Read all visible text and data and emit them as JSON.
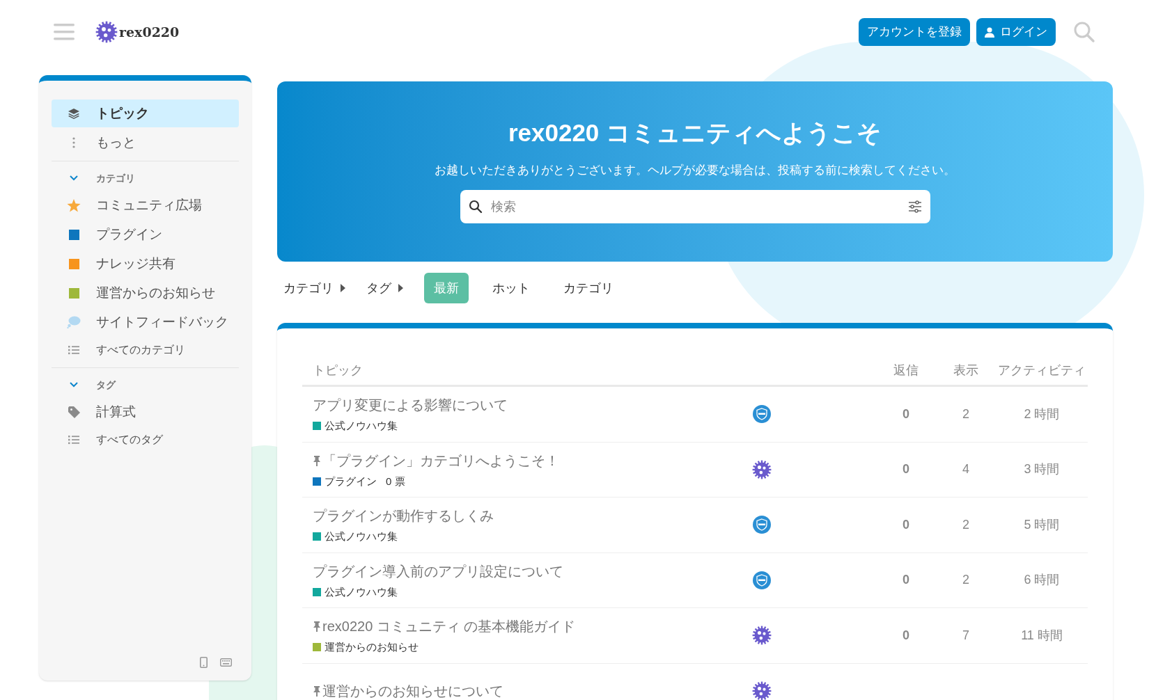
{
  "header": {
    "site_name": "rex0220",
    "buttons": [
      {
        "label": "アカウントを登録",
        "kind": "signup"
      },
      {
        "label": "ログイン",
        "kind": "login"
      }
    ]
  },
  "sidebar": {
    "top_items": [
      {
        "label": "トピック",
        "kind": "layers",
        "selected": true
      },
      {
        "label": "もっと",
        "kind": "dots",
        "selected": false
      }
    ],
    "sections": [
      {
        "title": "カテゴリ",
        "expanded": true,
        "items": [
          {
            "label": "コミュニティ広場",
            "kind": "star",
            "color": "#f7a93b"
          },
          {
            "label": "プラグイン",
            "kind": "square",
            "color": "#0e76bd"
          },
          {
            "label": "ナレッジ共有",
            "kind": "square",
            "color": "#f7941d"
          },
          {
            "label": "運営からのお知らせ",
            "kind": "square",
            "color": "#9eb83b"
          },
          {
            "label": "サイトフィードバック",
            "kind": "bubble",
            "color": "#b3d9f2"
          },
          {
            "label": "すべてのカテゴリ",
            "kind": "list"
          }
        ]
      },
      {
        "title": "タグ",
        "expanded": true,
        "items": [
          {
            "label": "計算式",
            "kind": "tag"
          },
          {
            "label": "すべてのタグ",
            "kind": "list"
          }
        ]
      }
    ]
  },
  "banner": {
    "title": "rex0220 コミュニティへようこそ",
    "subtitle": "お越しいただきありがとうございます。ヘルプが必要な場合は、投稿する前に検索してください。",
    "search": {
      "placeholder": "検索"
    }
  },
  "nav": {
    "dropdowns": [
      "カテゴリ",
      "タグ"
    ],
    "tabs": [
      {
        "label": "最新",
        "selected": true
      },
      {
        "label": "ホット",
        "selected": false
      },
      {
        "label": "カテゴリ",
        "selected": false
      }
    ]
  },
  "table": {
    "columns": [
      "トピック",
      "返信",
      "表示",
      "アクティビティ"
    ],
    "rows": [
      {
        "title": "アプリ変更による影響について",
        "pinned": false,
        "category": {
          "name": "公式ノウハウ集",
          "color": "#12a89d"
        },
        "avatar": {
          "kind": "staff"
        },
        "replies": "0",
        "views": "2",
        "activity": "2 時間"
      },
      {
        "title": "「プラグイン」カテゴリへようこそ！",
        "pinned": true,
        "category": {
          "name": "プラグイン",
          "color": "#0e76bd"
        },
        "votes": "0 票",
        "avatar": {
          "kind": "gear"
        },
        "replies": "0",
        "views": "4",
        "activity": "3 時間"
      },
      {
        "title": "プラグインが動作するしくみ",
        "pinned": false,
        "category": {
          "name": "公式ノウハウ集",
          "color": "#12a89d"
        },
        "avatar": {
          "kind": "staff"
        },
        "replies": "0",
        "views": "2",
        "activity": "5 時間"
      },
      {
        "title": "プラグイン導入前のアプリ設定について",
        "pinned": false,
        "category": {
          "name": "公式ノウハウ集",
          "color": "#12a89d"
        },
        "avatar": {
          "kind": "staff"
        },
        "replies": "0",
        "views": "2",
        "activity": "6 時間"
      },
      {
        "title": "rex0220 コミュニティ の基本機能ガイド",
        "pinned": true,
        "category": {
          "name": "運営からのお知らせ",
          "color": "#9eb83b"
        },
        "avatar": {
          "kind": "gear"
        },
        "replies": "0",
        "views": "7",
        "activity": "11 時間"
      },
      {
        "title": "運営からのお知らせについて",
        "pinned": true,
        "avatar": {
          "kind": "gear"
        }
      }
    ]
  }
}
